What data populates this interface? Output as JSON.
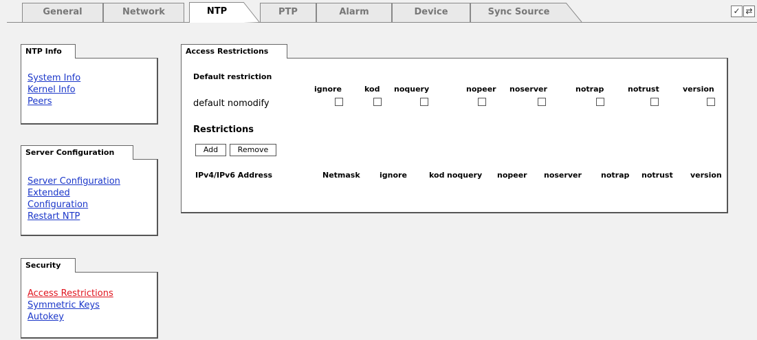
{
  "tabs": [
    {
      "label": "General"
    },
    {
      "label": "Network"
    },
    {
      "label": "NTP"
    },
    {
      "label": "PTP"
    },
    {
      "label": "Alarm"
    },
    {
      "label": "Device"
    },
    {
      "label": "Sync Source"
    }
  ],
  "active_tab": "NTP",
  "toolbar": {
    "apply_icon": "check-icon",
    "reload_icon": "reload-icon"
  },
  "sidebar": {
    "ntp_info": {
      "title": "NTP Info",
      "links": [
        "System Info",
        "Kernel Info",
        "Peers"
      ]
    },
    "server_config": {
      "title": "Server Configuration",
      "links": [
        "Server Configuration",
        "Extended Configuration",
        "Restart NTP"
      ]
    },
    "security": {
      "title": "Security",
      "links": [
        "Access Restrictions",
        "Symmetric Keys",
        "Autokey"
      ],
      "active": "Access Restrictions"
    }
  },
  "main": {
    "panel_title": "Access Restrictions",
    "default_restriction": {
      "heading": "Default restriction",
      "row_label": "default nomodify",
      "columns": [
        "ignore",
        "kod",
        "noquery",
        "nopeer",
        "noserver",
        "notrap",
        "notrust",
        "version"
      ],
      "checked": [
        false,
        false,
        false,
        false,
        false,
        false,
        false,
        false
      ]
    },
    "restrictions": {
      "heading": "Restrictions",
      "add_label": "Add",
      "remove_label": "Remove",
      "columns": [
        "IPv4/IPv6 Address",
        "Netmask",
        "ignore",
        "kod",
        "noquery",
        "nopeer",
        "noserver",
        "notrap",
        "notrust",
        "version"
      ]
    }
  },
  "colors": {
    "link": "#1a36c9",
    "active_link": "#e0141e",
    "background": "#f1f1f1"
  }
}
